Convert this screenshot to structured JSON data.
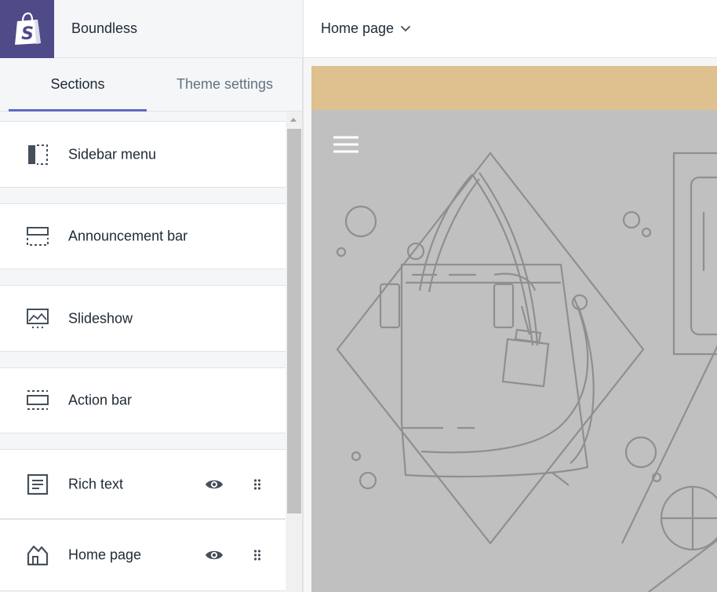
{
  "header": {
    "logo_icon": "shopify-bag-icon",
    "theme_name": "Boundless",
    "page_selector": {
      "label": "Home page",
      "icon": "chevron-down-icon"
    }
  },
  "tabs": [
    {
      "label": "Sections",
      "active": true
    },
    {
      "label": "Theme settings",
      "active": false
    }
  ],
  "sections": [
    {
      "label": "Sidebar menu",
      "icon": "sidebar-layout-icon",
      "controls": false
    },
    {
      "label": "Announcement bar",
      "icon": "announcement-bar-icon",
      "controls": false
    },
    {
      "label": "Slideshow",
      "icon": "slideshow-icon",
      "controls": false
    },
    {
      "label": "Action bar",
      "icon": "action-bar-icon",
      "controls": false
    },
    {
      "label": "Rich text",
      "icon": "rich-text-icon",
      "controls": true
    },
    {
      "label": "Home page",
      "icon": "home-page-icon",
      "controls": true
    }
  ],
  "preview": {
    "announcement_color": "#dec18f",
    "hero_color": "#c0c0c0",
    "line_color": "#8f8f8f"
  },
  "colors": {
    "brand": "#4f4a88",
    "tab_accent": "#5c6ac4",
    "icon": "#454f5b"
  }
}
